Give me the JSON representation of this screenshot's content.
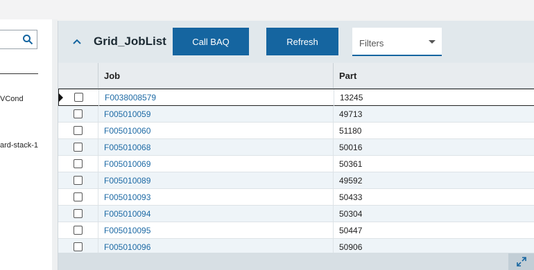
{
  "left_panel": {
    "items": [
      "VCond",
      "ard-stack-1"
    ]
  },
  "grid": {
    "title": "Grid_JobList",
    "call_baq_label": "Call BAQ",
    "refresh_label": "Refresh",
    "filters_placeholder": "Filters",
    "columns": {
      "job": "Job",
      "part": "Part"
    },
    "rows": [
      {
        "job": "F0038008579",
        "part": "13245"
      },
      {
        "job": "F005010059",
        "part": "49713"
      },
      {
        "job": "F005010060",
        "part": "51180"
      },
      {
        "job": "F005010068",
        "part": "50016"
      },
      {
        "job": "F005010069",
        "part": "50361"
      },
      {
        "job": "F005010089",
        "part": "49592"
      },
      {
        "job": "F005010093",
        "part": "50433"
      },
      {
        "job": "F005010094",
        "part": "50304"
      },
      {
        "job": "F005010095",
        "part": "50447"
      },
      {
        "job": "F005010096",
        "part": "50906"
      }
    ]
  },
  "icons": {
    "search": "search-icon",
    "collapse": "chevron-up-icon",
    "dropdown": "caret-down-icon",
    "expand": "expand-icon"
  },
  "colors": {
    "accent": "#1565a0",
    "link": "#1d6aa5"
  }
}
